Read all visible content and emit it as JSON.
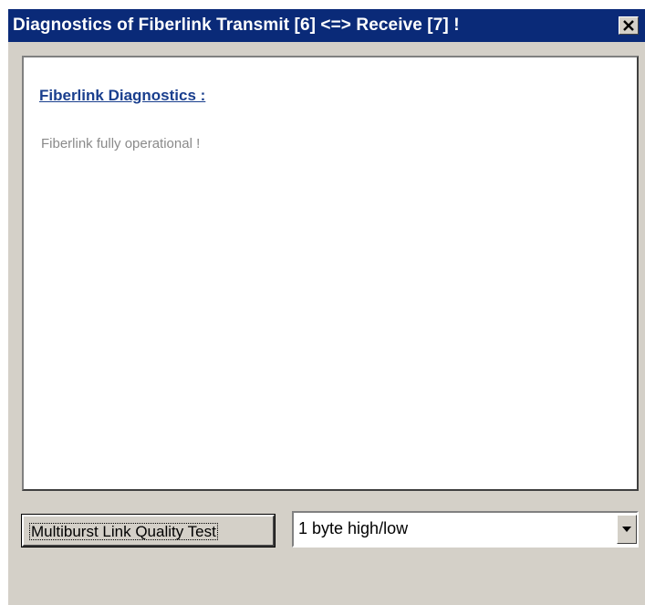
{
  "window": {
    "title": "Diagnostics of Fiberlink Transmit [6] <=> Receive [7] !",
    "close_icon": "close-icon",
    "colors": {
      "titlebar": "#0a2a78",
      "face": "#d4d0c8",
      "heading": "#1a3f8e",
      "status_text": "#8a8a8a"
    }
  },
  "diagnostics": {
    "heading": "Fiberlink Diagnostics :",
    "status": "Fiberlink fully operational !"
  },
  "controls": {
    "test_button_label": "Multiburst Link Quality Test",
    "mode_select": {
      "selected": "1 byte high/low",
      "arrow_icon": "chevron-down-icon"
    }
  }
}
